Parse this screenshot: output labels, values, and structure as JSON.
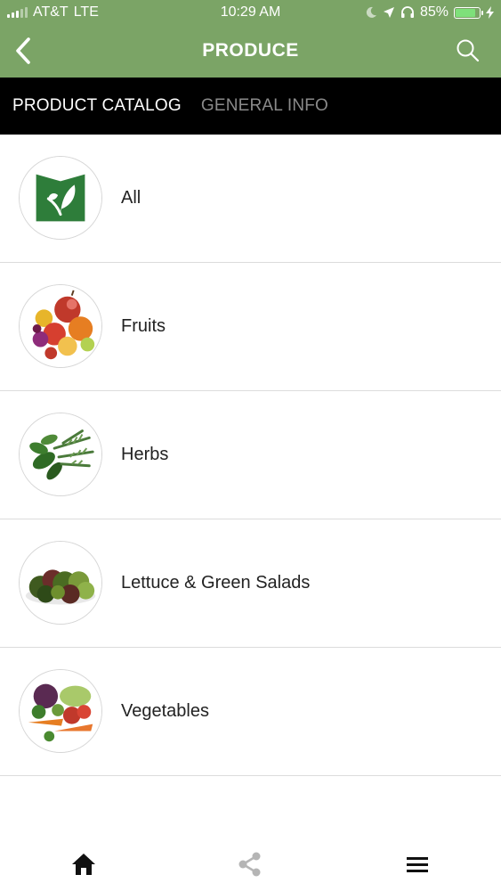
{
  "status_bar": {
    "carrier": "AT&T",
    "network": "LTE",
    "time": "10:29 AM",
    "battery_percent": "85%",
    "battery_level": 0.85,
    "icons": [
      "signal-icon",
      "moon-icon",
      "location-icon",
      "headphones-icon",
      "battery-icon",
      "charging-icon"
    ]
  },
  "header": {
    "title": "PRODUCE",
    "back_icon": "chevron-left-icon",
    "search_icon": "search-icon"
  },
  "tabs": [
    {
      "label": "PRODUCT CATALOG",
      "active": true
    },
    {
      "label": "GENERAL INFO",
      "active": false
    }
  ],
  "categories": [
    {
      "label": "All",
      "image": "logo-icon"
    },
    {
      "label": "Fruits",
      "image": "fruits-image"
    },
    {
      "label": "Herbs",
      "image": "herbs-image"
    },
    {
      "label": "Lettuce & Green Salads",
      "image": "lettuce-image"
    },
    {
      "label": "Vegetables",
      "image": "vegetables-image"
    }
  ],
  "bottom_nav": [
    {
      "icon": "home-icon",
      "active": true
    },
    {
      "icon": "share-icon",
      "active": false
    },
    {
      "icon": "menu-icon",
      "active": false
    }
  ],
  "colors": {
    "header_bg": "#7ba466",
    "tabs_bg": "#000000",
    "tab_active": "#ffffff",
    "tab_inactive": "#8a8a8a",
    "logo_green": "#2e7d3a",
    "divider": "#dcdcdc"
  }
}
